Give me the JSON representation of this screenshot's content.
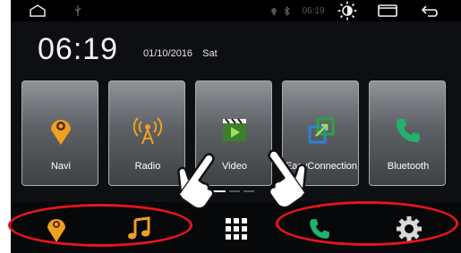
{
  "status": {
    "time": "06:19",
    "icons": [
      "home-icon",
      "usb-icon",
      "location-icon",
      "bluetooth-icon",
      "brightness-icon",
      "window-icon",
      "back-icon"
    ]
  },
  "clock": {
    "time": "06:19",
    "date": "01/10/2016",
    "day": "Sat"
  },
  "apps": [
    {
      "label": "Navi",
      "icon": "map-pin-icon"
    },
    {
      "label": "Radio",
      "icon": "radio-antenna-icon"
    },
    {
      "label": "Video",
      "icon": "video-clapper-icon"
    },
    {
      "label": "EasyConnection",
      "icon": "easyconnection-icon"
    },
    {
      "label": "Bluetooth",
      "icon": "phone-icon"
    }
  ],
  "dock": [
    "map-pin-icon",
    "music-note-icon",
    "app-grid-icon",
    "phone-icon",
    "gear-icon"
  ],
  "colors": {
    "highlight": "#e8141e",
    "nav_orange": "#f0a020",
    "phone_green": "#21b36b",
    "link_blue": "#2f80d8",
    "accent_white": "#ffffff"
  }
}
